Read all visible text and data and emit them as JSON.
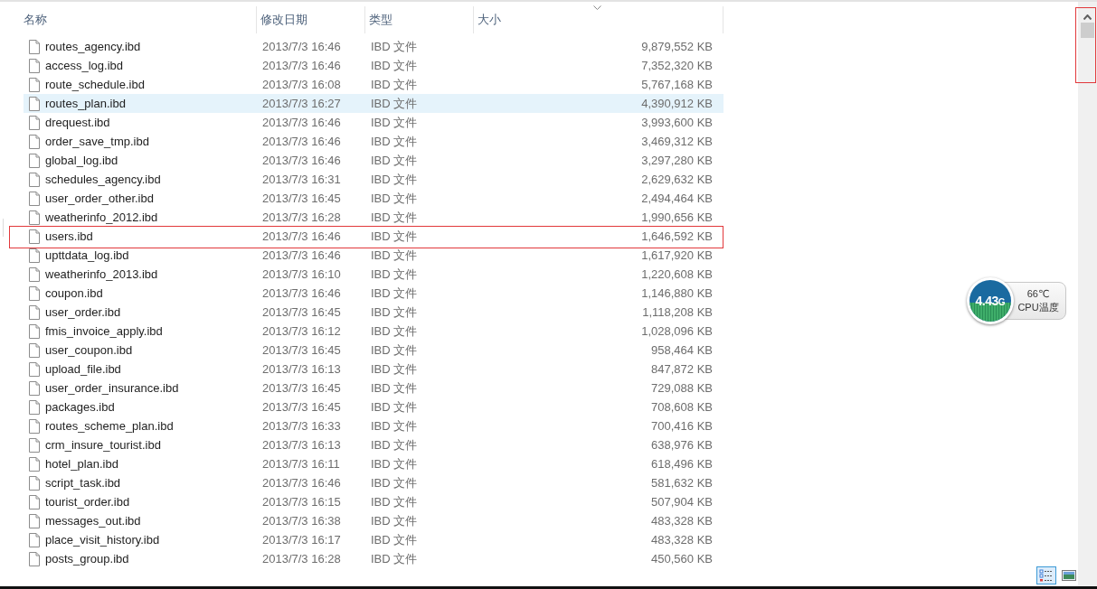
{
  "columns": [
    {
      "label": "名称"
    },
    {
      "label": "修改日期"
    },
    {
      "label": "类型"
    },
    {
      "label": "大小",
      "sorted": true
    }
  ],
  "files": [
    {
      "name": "routes_agency.ibd",
      "date": "2013/7/3 16:46",
      "type": "IBD 文件",
      "size": "9,879,552 KB",
      "selected": false,
      "marked": false
    },
    {
      "name": "access_log.ibd",
      "date": "2013/7/3 16:46",
      "type": "IBD 文件",
      "size": "7,352,320 KB",
      "selected": false,
      "marked": false
    },
    {
      "name": "route_schedule.ibd",
      "date": "2013/7/3 16:08",
      "type": "IBD 文件",
      "size": "5,767,168 KB",
      "selected": false,
      "marked": false
    },
    {
      "name": "routes_plan.ibd",
      "date": "2013/7/3 16:27",
      "type": "IBD 文件",
      "size": "4,390,912 KB",
      "selected": true,
      "marked": false
    },
    {
      "name": "drequest.ibd",
      "date": "2013/7/3 16:46",
      "type": "IBD 文件",
      "size": "3,993,600 KB",
      "selected": false,
      "marked": false
    },
    {
      "name": "order_save_tmp.ibd",
      "date": "2013/7/3 16:46",
      "type": "IBD 文件",
      "size": "3,469,312 KB",
      "selected": false,
      "marked": false
    },
    {
      "name": "global_log.ibd",
      "date": "2013/7/3 16:46",
      "type": "IBD 文件",
      "size": "3,297,280 KB",
      "selected": false,
      "marked": false
    },
    {
      "name": "schedules_agency.ibd",
      "date": "2013/7/3 16:31",
      "type": "IBD 文件",
      "size": "2,629,632 KB",
      "selected": false,
      "marked": false
    },
    {
      "name": "user_order_other.ibd",
      "date": "2013/7/3 16:45",
      "type": "IBD 文件",
      "size": "2,494,464 KB",
      "selected": false,
      "marked": false
    },
    {
      "name": "weatherinfo_2012.ibd",
      "date": "2013/7/3 16:28",
      "type": "IBD 文件",
      "size": "1,990,656 KB",
      "selected": false,
      "marked": false
    },
    {
      "name": "users.ibd",
      "date": "2013/7/3 16:46",
      "type": "IBD 文件",
      "size": "1,646,592 KB",
      "selected": false,
      "marked": true
    },
    {
      "name": "upttdata_log.ibd",
      "date": "2013/7/3 16:46",
      "type": "IBD 文件",
      "size": "1,617,920 KB",
      "selected": false,
      "marked": false
    },
    {
      "name": "weatherinfo_2013.ibd",
      "date": "2013/7/3 16:10",
      "type": "IBD 文件",
      "size": "1,220,608 KB",
      "selected": false,
      "marked": false
    },
    {
      "name": "coupon.ibd",
      "date": "2013/7/3 16:46",
      "type": "IBD 文件",
      "size": "1,146,880 KB",
      "selected": false,
      "marked": false
    },
    {
      "name": "user_order.ibd",
      "date": "2013/7/3 16:45",
      "type": "IBD 文件",
      "size": "1,118,208 KB",
      "selected": false,
      "marked": false
    },
    {
      "name": "fmis_invoice_apply.ibd",
      "date": "2013/7/3 16:12",
      "type": "IBD 文件",
      "size": "1,028,096 KB",
      "selected": false,
      "marked": false
    },
    {
      "name": "user_coupon.ibd",
      "date": "2013/7/3 16:45",
      "type": "IBD 文件",
      "size": "958,464 KB",
      "selected": false,
      "marked": false
    },
    {
      "name": "upload_file.ibd",
      "date": "2013/7/3 16:13",
      "type": "IBD 文件",
      "size": "847,872 KB",
      "selected": false,
      "marked": false
    },
    {
      "name": "user_order_insurance.ibd",
      "date": "2013/7/3 16:45",
      "type": "IBD 文件",
      "size": "729,088 KB",
      "selected": false,
      "marked": false
    },
    {
      "name": "packages.ibd",
      "date": "2013/7/3 16:45",
      "type": "IBD 文件",
      "size": "708,608 KB",
      "selected": false,
      "marked": false
    },
    {
      "name": "routes_scheme_plan.ibd",
      "date": "2013/7/3 16:33",
      "type": "IBD 文件",
      "size": "700,416 KB",
      "selected": false,
      "marked": false
    },
    {
      "name": "crm_insure_tourist.ibd",
      "date": "2013/7/3 16:13",
      "type": "IBD 文件",
      "size": "638,976 KB",
      "selected": false,
      "marked": false
    },
    {
      "name": "hotel_plan.ibd",
      "date": "2013/7/3 16:11",
      "type": "IBD 文件",
      "size": "618,496 KB",
      "selected": false,
      "marked": false
    },
    {
      "name": "script_task.ibd",
      "date": "2013/7/3 16:46",
      "type": "IBD 文件",
      "size": "581,632 KB",
      "selected": false,
      "marked": false
    },
    {
      "name": "tourist_order.ibd",
      "date": "2013/7/3 16:15",
      "type": "IBD 文件",
      "size": "507,904 KB",
      "selected": false,
      "marked": false
    },
    {
      "name": "messages_out.ibd",
      "date": "2013/7/3 16:38",
      "type": "IBD 文件",
      "size": "483,328 KB",
      "selected": false,
      "marked": false
    },
    {
      "name": "place_visit_history.ibd",
      "date": "2013/7/3 16:17",
      "type": "IBD 文件",
      "size": "483,328 KB",
      "selected": false,
      "marked": false
    },
    {
      "name": "posts_group.ibd",
      "date": "2013/7/3 16:28",
      "type": "IBD 文件",
      "size": "450,560 KB",
      "selected": false,
      "marked": false
    }
  ],
  "scrollbar": {
    "marked": true
  },
  "cpu_widget": {
    "frequency": "4.43",
    "unit": "G",
    "temperature": "66℃",
    "label": "CPU温度"
  },
  "view_buttons": [
    {
      "kind": "details",
      "selected": true
    },
    {
      "kind": "large-icons",
      "selected": false
    }
  ]
}
